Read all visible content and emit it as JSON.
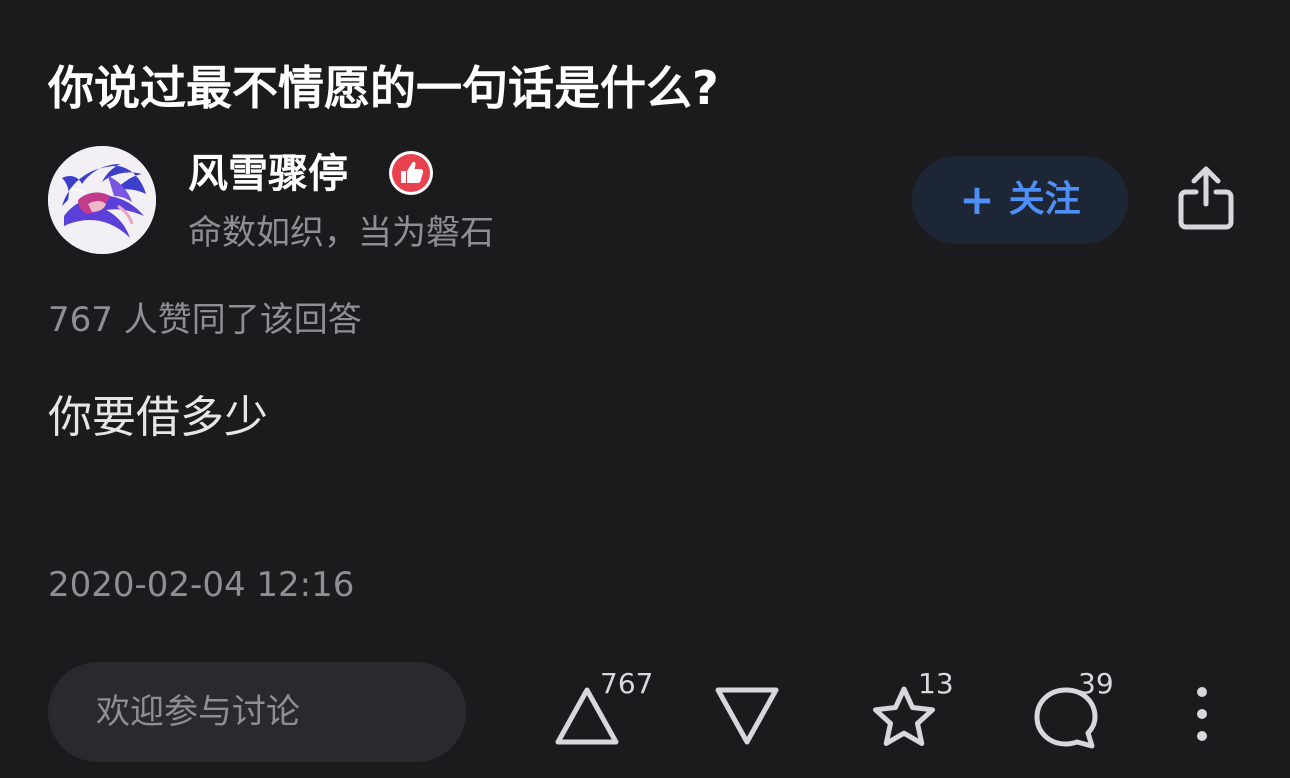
{
  "question": {
    "title": "你说过最不情愿的一句话是什么?"
  },
  "author": {
    "name": "风雪骤停",
    "bio": "命数如织，当为磐石",
    "badge_icon": "thumbs-up-badge-icon",
    "avatar_icon": "illustrated-avatar"
  },
  "follow": {
    "plus": "+",
    "label": "关注"
  },
  "share": {
    "icon": "share-icon"
  },
  "upvote_summary": "767 人赞同了该回答",
  "answer": {
    "content": "你要借多少",
    "time": "2020-02-04 12:16"
  },
  "comment": {
    "placeholder": "欢迎参与讨论"
  },
  "actions": {
    "upvote_count": "767",
    "favorite_count": "13",
    "comment_count": "39",
    "icons": [
      "upvote-icon",
      "downvote-icon",
      "star-icon",
      "comment-icon",
      "more-icon"
    ]
  },
  "colors": {
    "background": "#1b1b1e",
    "accent": "#4d8ef7",
    "secondary_text": "#8e8e93",
    "badge": "#e8424f"
  }
}
